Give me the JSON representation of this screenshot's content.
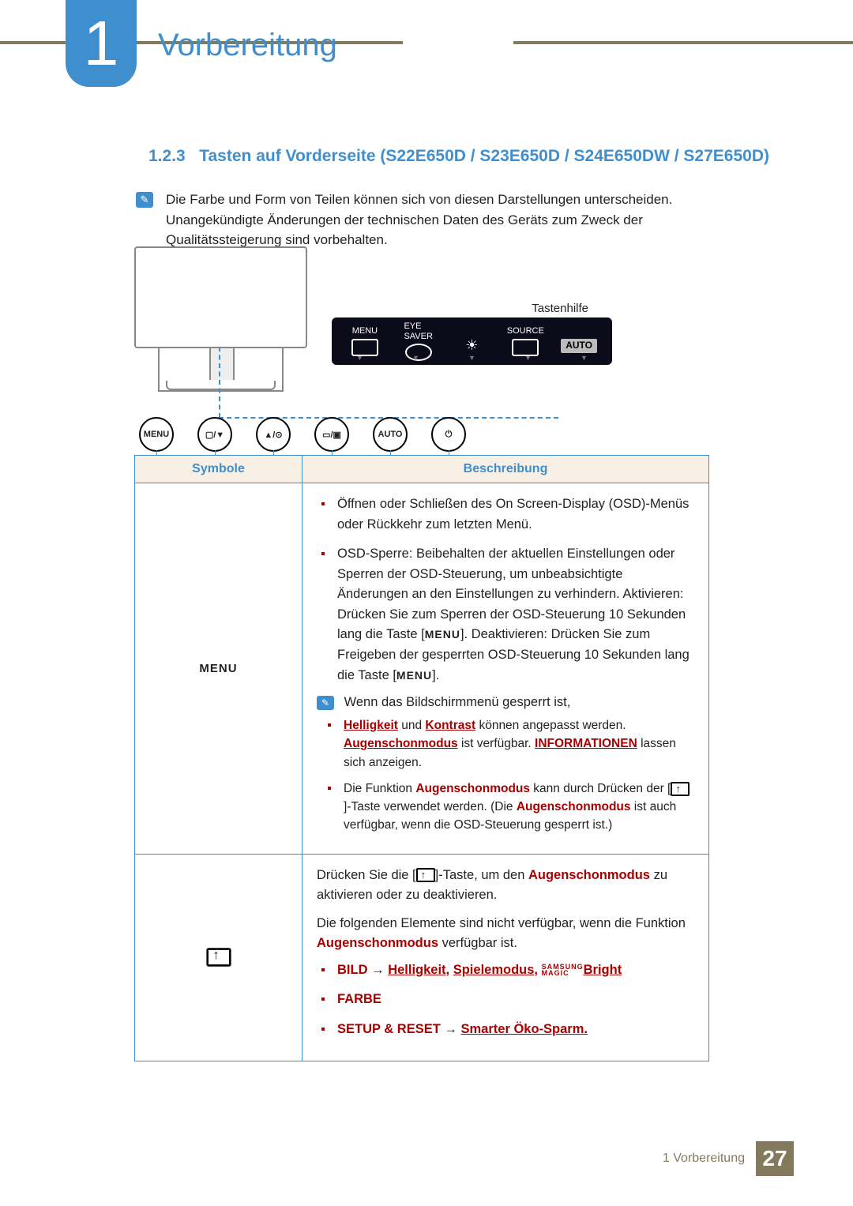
{
  "chapter": {
    "number": "1",
    "title": "Vorbereitung"
  },
  "section": {
    "number": "1.2.3",
    "title": "Tasten auf Vorderseite (S22E650D / S23E650D / S24E650DW / S27E650D)"
  },
  "intro_note": "Die Farbe und Form von Teilen können sich von diesen Darstellungen unterscheiden. Unangekündigte Änderungen der technischen Daten des Geräts zum Zweck der Qualitätssteigerung sind vorbehalten.",
  "diagram": {
    "help_label": "Tastenhilfe",
    "osd": {
      "menu": "MENU",
      "eye": "EYE\nSAVER",
      "source": "SOURCE",
      "auto": "AUTO"
    },
    "buttons": {
      "menu": "MENU",
      "auto": "AUTO"
    }
  },
  "table": {
    "headers": {
      "symbol": "Symbole",
      "desc": "Beschreibung"
    },
    "row1": {
      "symbol": "MENU",
      "b1": "Öffnen oder Schließen des On Screen-Display (OSD)-Menüs oder Rückkehr zum letzten Menü.",
      "b2_a": "OSD-Sperre: Beibehalten der aktuellen Einstellungen oder Sperren der OSD-Steuerung, um unbeabsichtigte Änderungen an den Einstellungen zu verhindern. Aktivieren: Drücken Sie zum Sperren der OSD-Steuerung 10 Sekunden lang die Taste [",
      "b2_b": "]. Deaktivieren: Drücken Sie zum Freigeben der gesperrten OSD-Steuerung 10 Sekunden lang die Taste [",
      "b2_c": "].",
      "locked": "Wenn das Bildschirmmenü gesperrt ist,",
      "s1": {
        "a": "Helligkeit",
        "b": " und ",
        "c": "Kontrast",
        "d": " können angepasst werden. ",
        "e": "Augenschonmodus",
        "f": " ist verfügbar. ",
        "g": "INFORMATIONEN",
        "h": " lassen sich anzeigen."
      },
      "s2": {
        "a": "Die Funktion ",
        "b": "Augenschonmodus",
        "c": " kann durch Drücken der [",
        "d": "]-Taste verwendet werden. (Die ",
        "e": "Augenschonmodus",
        "f": " ist auch verfügbar, wenn die OSD-Steuerung gesperrt ist.)"
      }
    },
    "row2": {
      "p1": {
        "a": "Drücken Sie die [",
        "b": "]-Taste, um den ",
        "c": "Augenschonmodus",
        "d": " zu aktivieren oder zu deaktivieren."
      },
      "p2": {
        "a": "Die folgenden Elemente sind nicht verfügbar, wenn die Funktion ",
        "b": "Augenschonmodus",
        "c": " verfügbar ist."
      },
      "items": {
        "bild": "BILD",
        "arrow": " → ",
        "hell": "Helligkeit",
        "spiel": "Spielemodus",
        "bright": "Bright",
        "farbe": "FARBE",
        "setup": "SETUP & RESET",
        "oko": "Smarter Öko-Sparm."
      },
      "magic_top": "SAMSUNG",
      "magic_bot": "MAGIC"
    }
  },
  "footer": {
    "label": "1 Vorbereitung",
    "page": "27"
  }
}
